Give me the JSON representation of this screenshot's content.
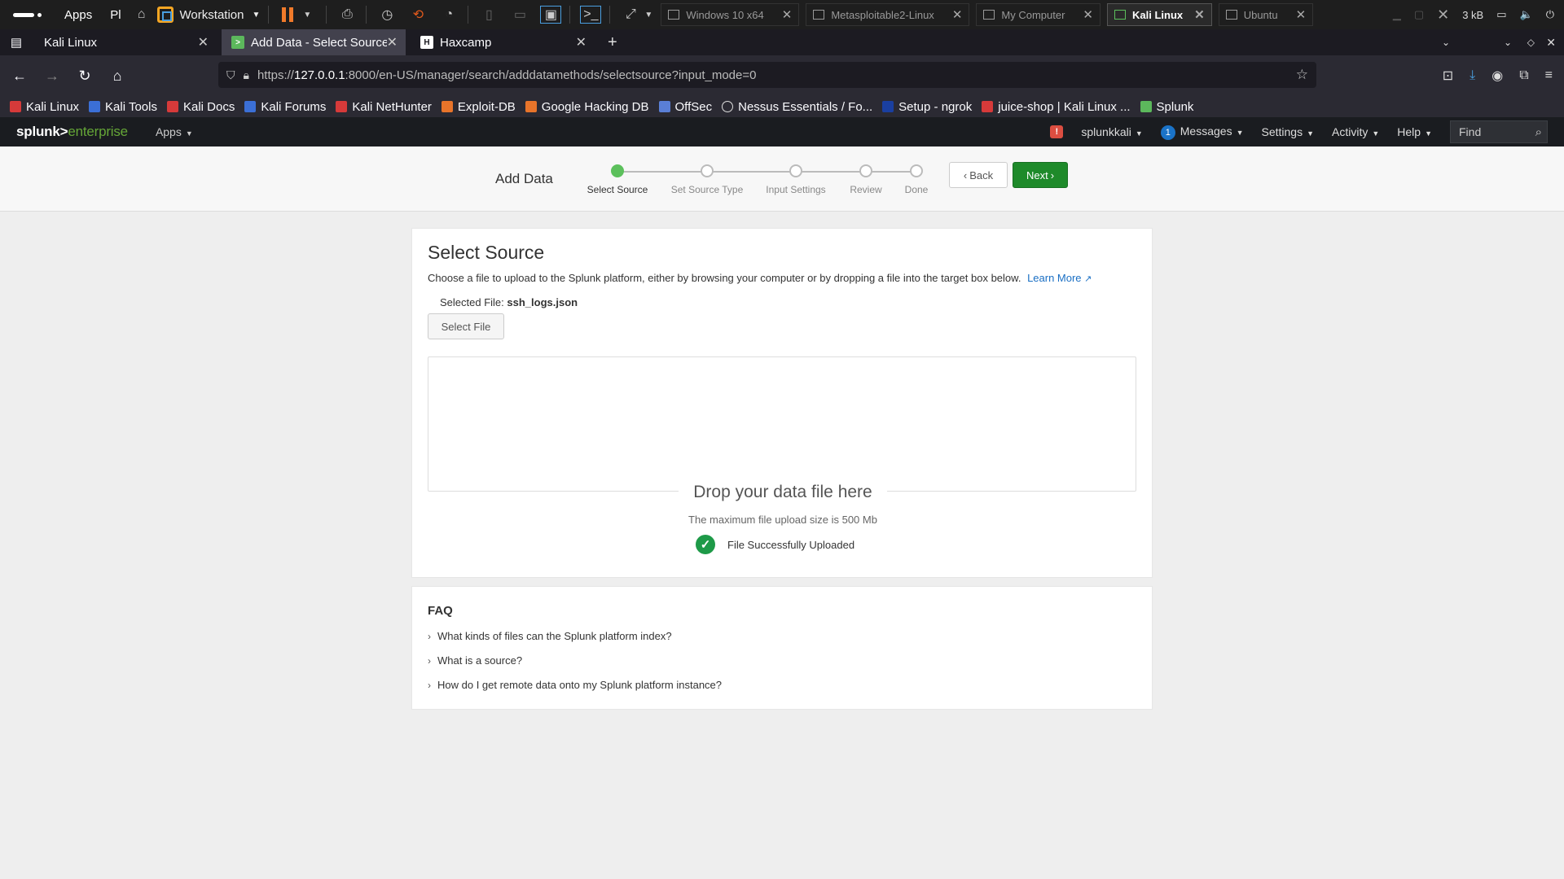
{
  "vm": {
    "apps_label": "Apps",
    "places_label": "Pl",
    "workstation_label": "Workstation",
    "tabs": [
      {
        "label": "Windows 10 x64",
        "active": false
      },
      {
        "label": "Metasploitable2-Linux",
        "active": false
      },
      {
        "label": "My Computer",
        "active": false
      },
      {
        "label": "Kali Linux",
        "active": true
      },
      {
        "label": "Ubuntu",
        "active": false
      }
    ],
    "net_speed": "3 kB"
  },
  "browser": {
    "tabs": [
      {
        "label": "Kali Linux",
        "active": false
      },
      {
        "label": "Add Data - Select Source",
        "active": true
      },
      {
        "label": "Haxcamp",
        "active": false
      }
    ],
    "url_prefix": "https://",
    "url_host": "127.0.0.1",
    "url_rest": ":8000/en-US/manager/search/adddatamethods/selectsource?input_mode=0",
    "bookmarks": [
      {
        "label": "Kali Linux",
        "color": "#d63a3a"
      },
      {
        "label": "Kali Tools",
        "color": "#3b6fd6"
      },
      {
        "label": "Kali Docs",
        "color": "#d63a3a"
      },
      {
        "label": "Kali Forums",
        "color": "#3b6fd6"
      },
      {
        "label": "Kali NetHunter",
        "color": "#d63a3a"
      },
      {
        "label": "Exploit-DB",
        "color": "#e8742a"
      },
      {
        "label": "Google Hacking DB",
        "color": "#e8742a"
      },
      {
        "label": "OffSec",
        "color": "#5a7fd6"
      },
      {
        "label": "Nessus Essentials / Fo...",
        "color": "#888888"
      },
      {
        "label": "Setup - ngrok",
        "color": "#1a3fa0"
      },
      {
        "label": "juice-shop | Kali Linux ...",
        "color": "#d63a3a"
      },
      {
        "label": "Splunk",
        "color": "#5cb85c"
      }
    ]
  },
  "splunk": {
    "logo_white": "splunk>",
    "logo_green": "enterprise",
    "apps_menu": "Apps",
    "user": "splunkkali",
    "messages_count": "1",
    "messages": "Messages",
    "settings": "Settings",
    "activity": "Activity",
    "help": "Help",
    "find_placeholder": "Find"
  },
  "wizard": {
    "title": "Add Data",
    "steps": [
      "Select Source",
      "Set Source Type",
      "Input Settings",
      "Review",
      "Done"
    ],
    "current_step": 1,
    "back_label": "Back",
    "next_label": "Next"
  },
  "source": {
    "heading": "Select Source",
    "description": "Choose a file to upload to the Splunk platform, either by browsing your computer or by dropping a file into the target box below.",
    "learn_more": "Learn More",
    "selected_file_label": "Selected File:",
    "selected_file_name": "ssh_logs.json",
    "select_file_button": "Select File",
    "drop_text": "Drop your data file here",
    "max_size_text": "The maximum file upload size is 500 Mb",
    "upload_status": "File Successfully Uploaded"
  },
  "faq": {
    "heading": "FAQ",
    "items": [
      "What kinds of files can the Splunk platform index?",
      "What is a source?",
      "How do I get remote data onto my Splunk platform instance?"
    ]
  }
}
